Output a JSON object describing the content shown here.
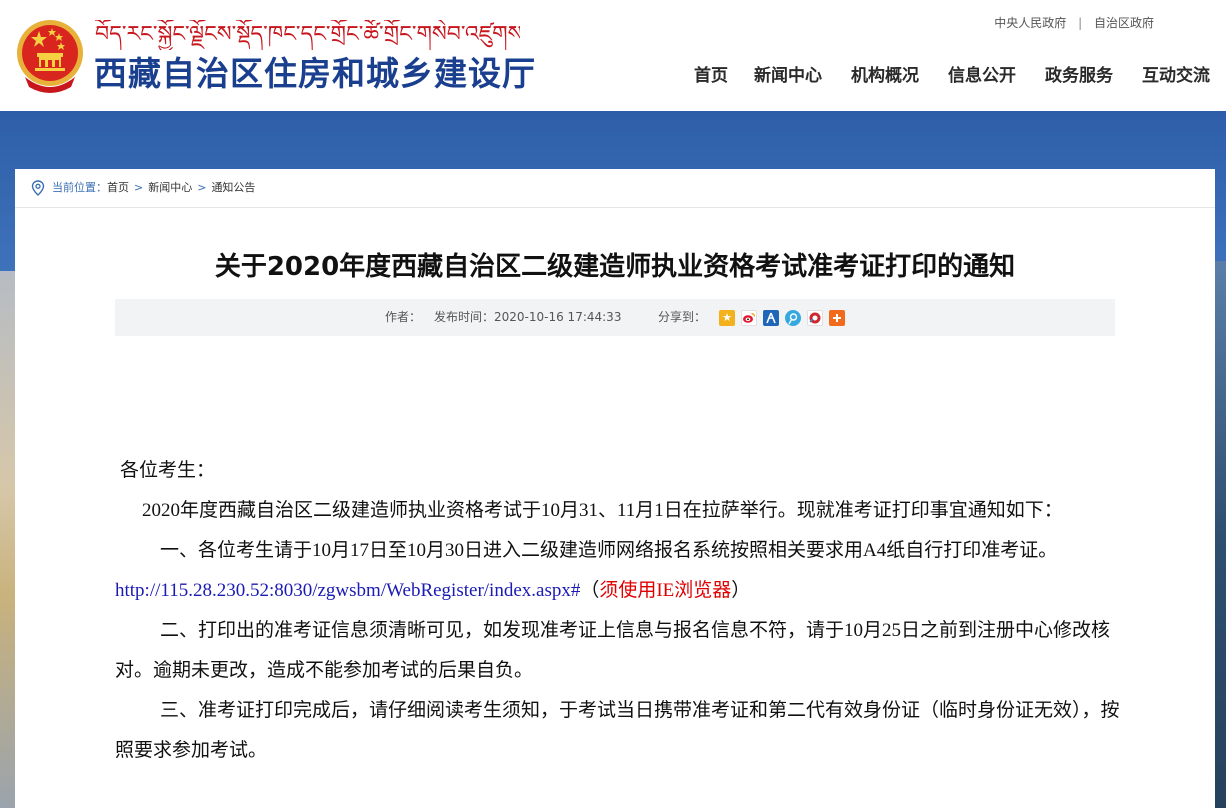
{
  "header": {
    "tibetan_name": "བོད་རང་སྐྱོང་ལྗོངས་སྡོད་ཁང་དང་གྲོང་ཚོ་གྲོང་གསེབ་འཛུགས་སྐྲུན་ཐིང་།",
    "site_title": "西藏自治区住房和城乡建设厅",
    "top_links": [
      "中央人民政府",
      "自治区政府"
    ],
    "top_links_separator": "|",
    "nav": [
      "首页",
      "新闻中心",
      "机构概况",
      "信息公开",
      "政务服务",
      "互动交流"
    ]
  },
  "breadcrumb": {
    "label": "当前位置：",
    "items": [
      "首页",
      "新闻中心",
      "通知公告"
    ],
    "separator": ">"
  },
  "article": {
    "title": "关于2020年度西藏自治区二级建造师执业资格考试准考证打印的通知",
    "meta": {
      "author_label": "作者：",
      "pubtime": "发布时间：2020-10-16 17:44:33",
      "share_label": "分享到："
    },
    "share_icons": [
      "qzone-icon",
      "weibo-icon",
      "renren-icon",
      "tencent-weibo-icon",
      "pengyou-icon",
      "more-share-icon"
    ],
    "greeting": "各位考生：",
    "intro": "2020年度西藏自治区二级建造师执业资格考试于10月31、11月1日在拉萨举行。现就准考证打印事宜通知如下：",
    "item1_text": "一、各位考生请于10月17日至10月30日进入二级建造师网络报名系统按照相关要求用A4纸自行打印准考证。",
    "item1_url": "http://115.28.230.52:8030/zgwsbm/WebRegister/index.aspx#",
    "item1_paren_open": "（",
    "item1_note": "须使用IE浏览器",
    "item1_paren_close": "）",
    "item2": "二、打印出的准考证信息须清晰可见，如发现准考证上信息与报名信息不符，请于10月25日之前到注册中心修改核对。逾期未更改，造成不能参加考试的后果自负。",
    "item3": "三、准考证打印完成后，请仔细阅读考生须知，于考试当日携带准考证和第二代有效身份证（临时身份证无效），按照要求参加考试。"
  },
  "colors": {
    "brand_blue": "#1a3f8f",
    "tibetan_red": "#c8161d",
    "link_blue": "#1a1ab4",
    "note_red": "#e00000"
  }
}
